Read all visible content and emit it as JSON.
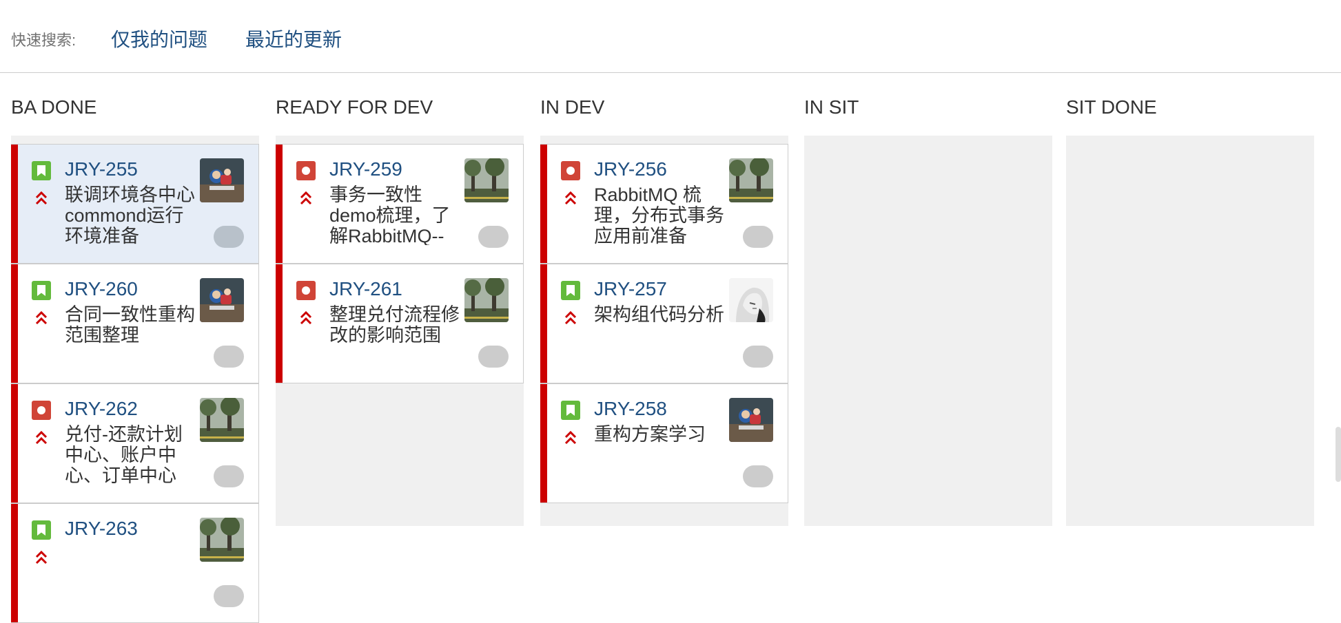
{
  "quick_search": {
    "label": "快速搜索:",
    "links": [
      "仅我的问题",
      "最近的更新"
    ]
  },
  "columns": [
    {
      "name": "BA DONE",
      "cards": [
        {
          "key": "JRY-255",
          "type": "story",
          "summary": "联调环境各中心commond运行环境准备",
          "avatar": "park-photo-avatar",
          "selected": true
        },
        {
          "key": "JRY-260",
          "type": "story",
          "summary": "合同一致性重构范围整理",
          "avatar": "park-photo-avatar"
        },
        {
          "key": "JRY-262",
          "type": "bug",
          "summary": "兑付-还款计划中心、账户中心、订单中心",
          "avatar": "trees-photo-avatar"
        },
        {
          "key": "JRY-263",
          "type": "story",
          "summary": "",
          "avatar": "trees-photo-avatar"
        }
      ]
    },
    {
      "name": "READY FOR DEV",
      "cards": [
        {
          "key": "JRY-259",
          "type": "bug",
          "summary": "事务一致性demo梳理，了解RabbitMQ--",
          "avatar": "trees-photo-avatar"
        },
        {
          "key": "JRY-261",
          "type": "bug",
          "summary": "整理兑付流程修改的影响范围",
          "avatar": "trees-photo-avatar"
        }
      ]
    },
    {
      "name": "IN DEV",
      "cards": [
        {
          "key": "JRY-256",
          "type": "bug",
          "summary": "RabbitMQ 梳理，分布式事务应用前准备",
          "avatar": "trees-photo-avatar"
        },
        {
          "key": "JRY-257",
          "type": "story",
          "summary": "架构组代码分析",
          "avatar": "anime-avatar"
        },
        {
          "key": "JRY-258",
          "type": "story",
          "summary": "重构方案学习",
          "avatar": "park-photo-avatar"
        }
      ]
    },
    {
      "name": "IN SIT",
      "cards": []
    },
    {
      "name": "SIT DONE",
      "cards": []
    }
  ],
  "colors": {
    "link": "#205081",
    "grabber": "#cc0000",
    "story": "#63ba3c",
    "bug": "#d04437",
    "priority": "#cc0000"
  }
}
